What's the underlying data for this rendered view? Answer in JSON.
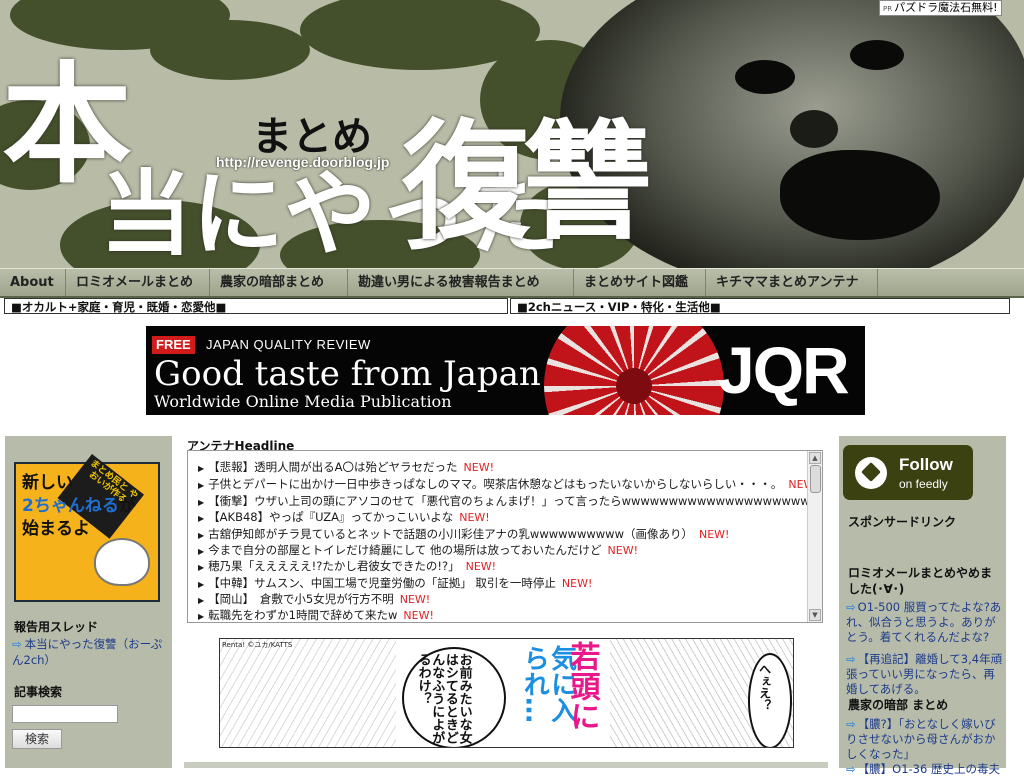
{
  "header": {
    "title_part1": "本",
    "title_part2": "当にやった",
    "title_part3": "復讐",
    "title_small": "まとめ",
    "url": "http://revenge.doorblog.jp",
    "top_ad_pr": "PR",
    "top_ad_text": "パズドラ魔法石無料!"
  },
  "nav": {
    "items": [
      {
        "label": "About"
      },
      {
        "label": "ロミオメールまとめ"
      },
      {
        "label": "農家の暗部まとめ"
      },
      {
        "label": "勘違い男による被害報告まとめ"
      },
      {
        "label": "まとめサイト図鑑"
      },
      {
        "label": "キチママまとめアンテナ"
      }
    ]
  },
  "subnav": {
    "left": "■オカルト+家庭・育児・既婚・恋愛他■",
    "right": "■2chニュース・VIP・特化・生活他■"
  },
  "jqr_ad": {
    "free": "FREE",
    "quality": "JAPAN QUALITY REVIEW",
    "tagline": "Good taste from Japan",
    "sub": "Worldwide Online Media Publication",
    "logo": "JQR"
  },
  "left_sidebar": {
    "promo": {
      "ribbon": "まとめ民と やおいが作る",
      "line1": "新しい",
      "line2": "2ちゃんねる",
      "line2b": "が",
      "line3": "始まるよ"
    },
    "report_title": "報告用スレッド",
    "report_link": "本当にやった復讐（おーぷん2ch）",
    "search_title": "記事検索",
    "search_button": "検索"
  },
  "center": {
    "antenna_title": "アンテナHeadline",
    "new_label": "NEW!",
    "headlines": [
      "【悲報】透明人間が出るA〇は殆どヤラセだった",
      "子供とデパートに出かけ一日中歩きっぱなしのママ。喫茶店休憩などはもったいないからしないらしい・・・。",
      "【衝撃】ウザい上司の頭にアソコのせて「悪代官のちょんまげ！」って言ったらwwwwwwwwwwwwwwwwwwwwwwww",
      "【AKB48】やっぱ『UZA』ってかっこいいよな",
      "古舘伊知郎がチラ見ているとネットで話題の小川彩佳アナの乳wwwwwwwwww（画像あり）",
      "今まで自分の部屋とトイレだけ綺麗にして 他の場所は放っておいたんだけど",
      "穂乃果「えええええ!?たかし君彼女できたの!?」",
      "【中韓】サムスン、中国工場で児童労働の「証拠」 取引を一時停止",
      "【岡山】　倉敷で小5女児が行方不明",
      "転職先をわずか1時間で辞めて来たw"
    ],
    "manga": {
      "copyright": "Renta! ©ユカ/KATTS",
      "speech_text": "お前みたいな女はシてるときどんなふうによがるわけ？",
      "catch_blue": "気に入られ…",
      "catch_pink": "若頭に",
      "bubble": "へぇえ？"
    }
  },
  "right_sidebar": {
    "feedly_follow": "Follow",
    "feedly_on": "on feedly",
    "sponsored": "スポンサードリンク",
    "section1": "ロミオメールまとめやめました(･∀･)",
    "links1": [
      "O1-500 服買ってたよな?あれ、似合うと思うよ。ありがとう。着てくれるんだよな?",
      "【再追記】離婚して3,4年頑張っていい男になったら、再婚してあげる。"
    ],
    "section2": "農家の暗部 まとめ",
    "links2": [
      "【膿?】「おとなしく嫁いびりさせないから母さんがおかしくなった」",
      "【膿】O1-36 歴史上の毒夫"
    ]
  },
  "colors": {
    "nav_bg": "#a8ae95",
    "sidebar_bg": "#b7bcaa",
    "new_badge": "#e02222",
    "link": "#1d3a8a",
    "feedly_bg": "#3b4110"
  }
}
